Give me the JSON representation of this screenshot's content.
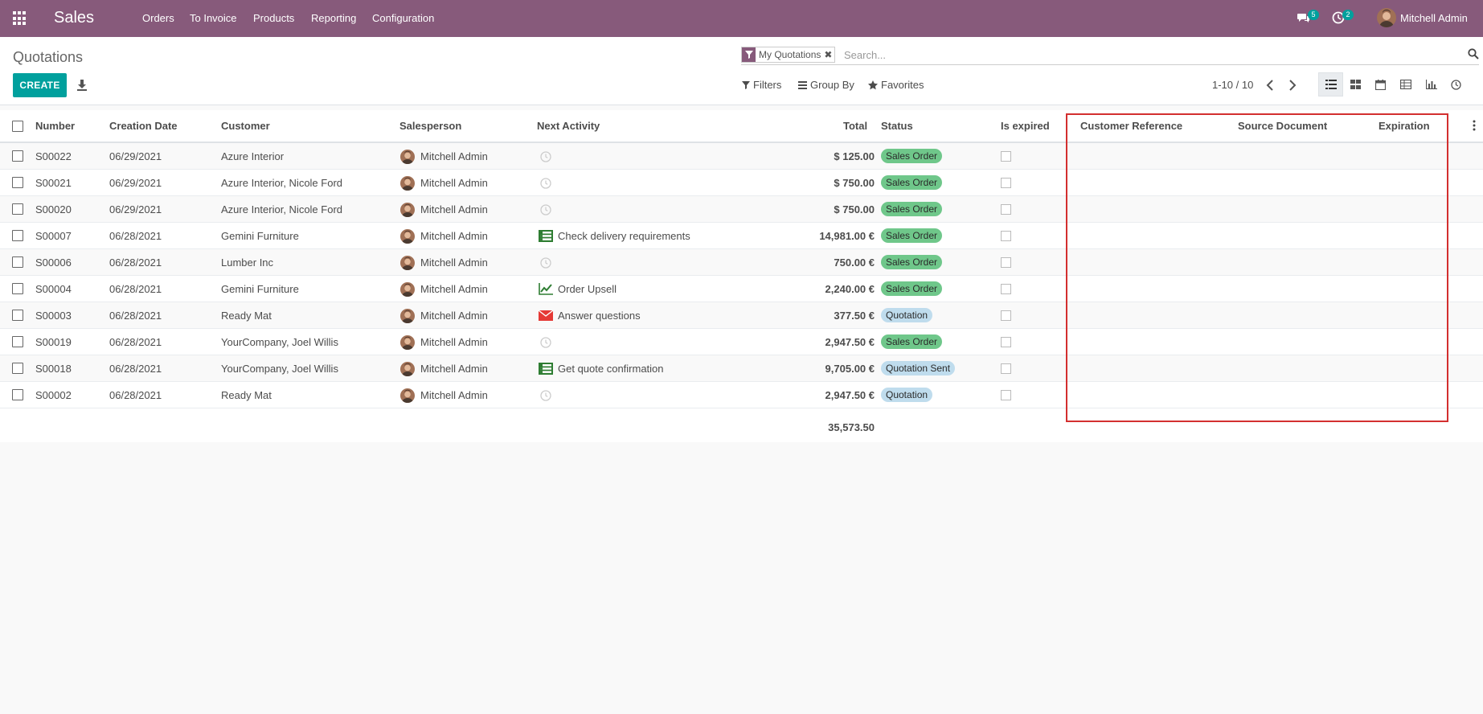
{
  "navbar": {
    "app_name": "Sales",
    "menu": [
      "Orders",
      "To Invoice",
      "Products",
      "Reporting",
      "Configuration"
    ],
    "messages_count": "5",
    "activities_count": "2",
    "user_name": "Mitchell Admin"
  },
  "control_panel": {
    "breadcrumb": "Quotations",
    "create_label": "CREATE",
    "facet_label": "My Quotations",
    "search_placeholder": "Search...",
    "filters_label": "Filters",
    "group_by_label": "Group By",
    "favorites_label": "Favorites",
    "pager": "1-10 / 10"
  },
  "table": {
    "columns": {
      "number": "Number",
      "creation_date": "Creation Date",
      "customer": "Customer",
      "salesperson": "Salesperson",
      "next_activity": "Next Activity",
      "total": "Total",
      "status": "Status",
      "is_expired": "Is expired",
      "customer_reference": "Customer Reference",
      "source_document": "Source Document",
      "expiration": "Expiration"
    },
    "rows": [
      {
        "number": "S00022",
        "date": "06/29/2021",
        "customer": "Azure Interior",
        "salesperson": "Mitchell Admin",
        "activity": "",
        "activity_icon": "clock-icon",
        "total": "$ 125.00",
        "status": "Sales Order"
      },
      {
        "number": "S00021",
        "date": "06/29/2021",
        "customer": "Azure Interior, Nicole Ford",
        "salesperson": "Mitchell Admin",
        "activity": "",
        "activity_icon": "clock-icon",
        "total": "$ 750.00",
        "status": "Sales Order"
      },
      {
        "number": "S00020",
        "date": "06/29/2021",
        "customer": "Azure Interior, Nicole Ford",
        "salesperson": "Mitchell Admin",
        "activity": "",
        "activity_icon": "clock-icon",
        "total": "$ 750.00",
        "status": "Sales Order"
      },
      {
        "number": "S00007",
        "date": "06/28/2021",
        "customer": "Gemini Furniture",
        "salesperson": "Mitchell Admin",
        "activity": "Check delivery requirements",
        "activity_icon": "tasks-icon",
        "total": "14,981.00 €",
        "status": "Sales Order"
      },
      {
        "number": "S00006",
        "date": "06/28/2021",
        "customer": "Lumber Inc",
        "salesperson": "Mitchell Admin",
        "activity": "",
        "activity_icon": "clock-icon",
        "total": "750.00 €",
        "status": "Sales Order"
      },
      {
        "number": "S00004",
        "date": "06/28/2021",
        "customer": "Gemini Furniture",
        "salesperson": "Mitchell Admin",
        "activity": "Order Upsell",
        "activity_icon": "line-chart-icon",
        "total": "2,240.00 €",
        "status": "Sales Order"
      },
      {
        "number": "S00003",
        "date": "06/28/2021",
        "customer": "Ready Mat",
        "salesperson": "Mitchell Admin",
        "activity": "Answer questions",
        "activity_icon": "envelope-icon",
        "total": "377.50 €",
        "status": "Quotation"
      },
      {
        "number": "S00019",
        "date": "06/28/2021",
        "customer": "YourCompany, Joel Willis",
        "salesperson": "Mitchell Admin",
        "activity": "",
        "activity_icon": "clock-icon",
        "total": "2,947.50 €",
        "status": "Sales Order"
      },
      {
        "number": "S00018",
        "date": "06/28/2021",
        "customer": "YourCompany, Joel Willis",
        "salesperson": "Mitchell Admin",
        "activity": "Get quote confirmation",
        "activity_icon": "tasks-icon",
        "total": "9,705.00 €",
        "status": "Quotation Sent"
      },
      {
        "number": "S00002",
        "date": "06/28/2021",
        "customer": "Ready Mat",
        "salesperson": "Mitchell Admin",
        "activity": "",
        "activity_icon": "clock-icon",
        "total": "2,947.50 €",
        "status": "Quotation"
      }
    ],
    "grand_total": "35,573.50"
  },
  "colors": {
    "brand": "#875a7b",
    "primary_button": "#00a09d",
    "sales_order_badge": "#6fc78a",
    "quotation_badge": "#bfdced",
    "highlight_box": "#d32f2f"
  }
}
